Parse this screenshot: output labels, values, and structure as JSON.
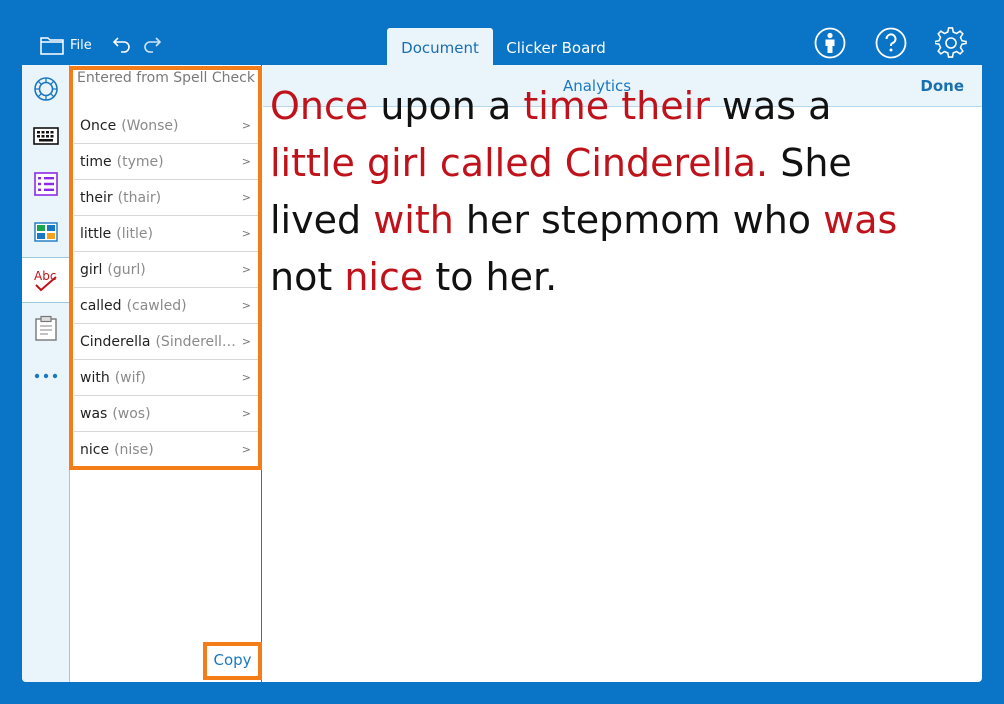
{
  "header": {
    "file_label": "File",
    "tabs": [
      {
        "label": "Document",
        "active": true
      },
      {
        "label": "Clicker Board",
        "active": false
      }
    ]
  },
  "sidebar": {
    "header": "Entered from Spell Check",
    "items": [
      {
        "word": "Once",
        "original": "(Wonse)"
      },
      {
        "word": "time",
        "original": "(tyme)"
      },
      {
        "word": "their",
        "original": "(thair)"
      },
      {
        "word": "little",
        "original": "(litle)"
      },
      {
        "word": "girl",
        "original": "(gurl)"
      },
      {
        "word": "called",
        "original": "(cawled)"
      },
      {
        "word": "Cinderella",
        "original": "(Sinderell…"
      },
      {
        "word": "with",
        "original": "(wif)"
      },
      {
        "word": "was",
        "original": "(wos)"
      },
      {
        "word": "nice",
        "original": "(nise)"
      }
    ],
    "chevron": ">",
    "copy_label": "Copy"
  },
  "docbar": {
    "analytics_label": "Analytics",
    "done_label": "Done"
  },
  "document": {
    "text_color": "#111111",
    "highlight_color": "#c0121a",
    "words": [
      {
        "t": "Once",
        "hl": true
      },
      {
        "t": " upon a ",
        "hl": false
      },
      {
        "t": "time",
        "hl": true
      },
      {
        "t": " ",
        "hl": false
      },
      {
        "t": "their",
        "hl": true
      },
      {
        "t": " was a ",
        "hl": false
      },
      {
        "t": "little",
        "hl": true
      },
      {
        "t": " ",
        "hl": false
      },
      {
        "t": "girl",
        "hl": true
      },
      {
        "t": " ",
        "hl": false
      },
      {
        "t": "called",
        "hl": true
      },
      {
        "t": " ",
        "hl": false
      },
      {
        "t": "Cinderella.",
        "hl": true
      },
      {
        "t": " She lived ",
        "hl": false
      },
      {
        "t": "with",
        "hl": true
      },
      {
        "t": " her stepmom who ",
        "hl": false
      },
      {
        "t": "was",
        "hl": true
      },
      {
        "t": " not ",
        "hl": false
      },
      {
        "t": "nice",
        "hl": true
      },
      {
        "t": " to her.",
        "hl": false
      }
    ]
  },
  "colors": {
    "accent": "#0a74c6",
    "highlight_orange": "#f57d18",
    "link_blue": "#1a78c2"
  }
}
